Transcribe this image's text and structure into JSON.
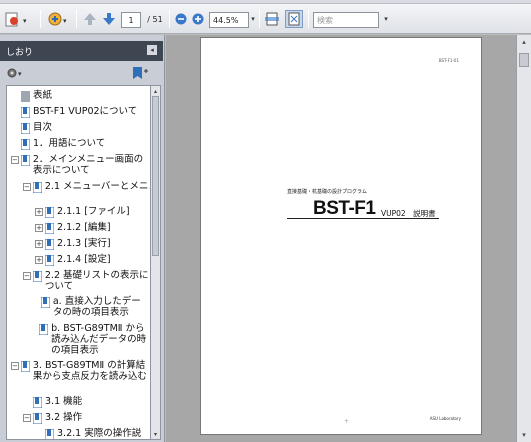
{
  "toolbar": {
    "page_current": "1",
    "page_total": "/ 51",
    "zoom": "44.5%",
    "search_placeholder": "検索"
  },
  "panel": {
    "title": "しおり",
    "close": "◂"
  },
  "bookmarks": [
    {
      "label": "表紙"
    },
    {
      "label": "BST-F1 VUP02について"
    },
    {
      "label": "目次"
    },
    {
      "label": "1．用語について"
    },
    {
      "label": "2．メインメニュー画面の表示について"
    },
    {
      "label": "2.1 メニューバーとメニュー"
    },
    {
      "label": "2.1.1 [ファイル]"
    },
    {
      "label": "2.1.2 [編集]"
    },
    {
      "label": "2.1.3 [実行]"
    },
    {
      "label": "2.1.4 [設定]"
    },
    {
      "label": "2.2 基礎リストの表示について"
    },
    {
      "label": "a. 直接入力したデータの時の項目表示"
    },
    {
      "label": "b. BST-G89TMⅡ から読み込んだデータの時の項目表示"
    },
    {
      "label": "3. BST-G89TMⅡ の計算結果から支点反力を読み込む"
    },
    {
      "label": "3.1 機能"
    },
    {
      "label": "3.2 操作"
    },
    {
      "label": "3.2.1 実際の操作説"
    }
  ],
  "document": {
    "header_small": "BST-F1-01",
    "subtitle": "直接基礎・杭基礎の設計プログラム",
    "title": "BST-F1",
    "title_suffix": "VUP02　説明書",
    "footer": "ASU Laboratory"
  },
  "colors": {
    "panel_header": "#3e4652",
    "bookmark_icon": "#2f6fb8"
  }
}
